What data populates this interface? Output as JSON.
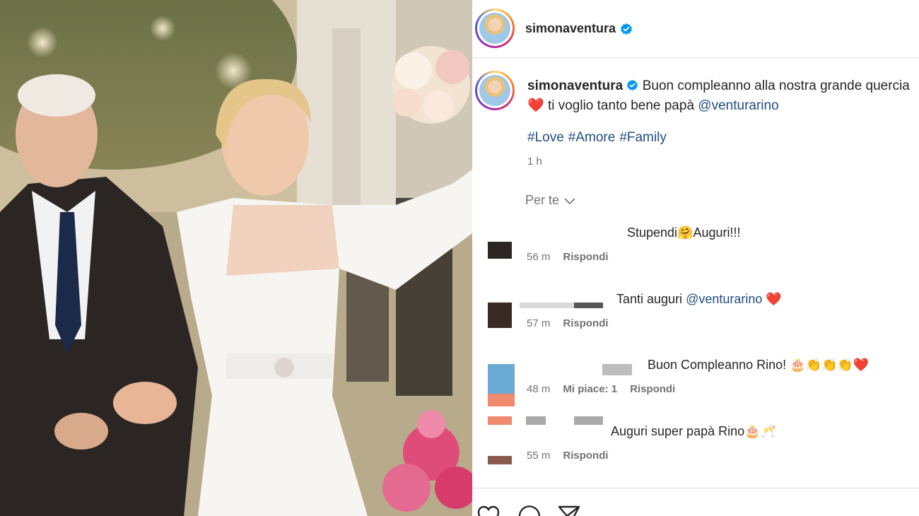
{
  "post": {
    "username": "simonaventura",
    "caption_text": "Buon compleanno alla nostra grande quercia",
    "caption_line2": "ti voglio tanto bene papà",
    "mention": "@venturarino",
    "hashtags": [
      "#Love",
      "#Amore",
      "#Family"
    ],
    "time": "1 h"
  },
  "sort_label": "Per te",
  "comments": [
    {
      "text": "Stupendi🤗Auguri!!!",
      "time": "56 m",
      "reply": "Rispondi"
    },
    {
      "text": "Tanti auguri",
      "mention": "@venturarino",
      "suffix": "❤️",
      "time": "57 m",
      "reply": "Rispondi"
    },
    {
      "text": "Buon Compleanno Rino! 🎂👏👏👏❤️",
      "time": "48 m",
      "likes": "Mi piace: 1",
      "reply": "Rispondi"
    },
    {
      "text": "Auguri super papà Rino🎂🥂",
      "time": "55 m",
      "reply": "Rispondi"
    }
  ],
  "icons": [
    "heart-icon",
    "comment-icon",
    "share-icon",
    "verified-badge-icon",
    "chevron-down-icon"
  ],
  "colors": {
    "link": "#234d80",
    "verified": "#0095f6",
    "heart": "#e0245e",
    "meta": "#737373"
  }
}
